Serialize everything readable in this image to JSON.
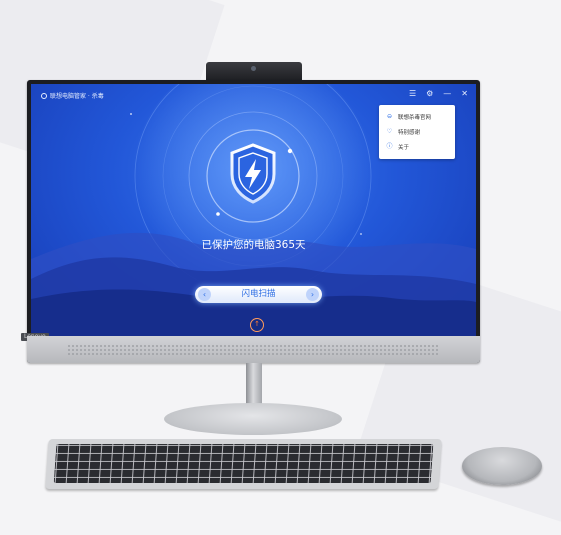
{
  "app": {
    "title": "联想电脑管家 · 杀毒",
    "controls": {
      "menu": "☰",
      "settings": "⚙",
      "minimize": "—",
      "close": "✕"
    }
  },
  "menu": {
    "items": [
      {
        "label": "联想杀毒官网",
        "icon": "web-icon"
      },
      {
        "label": "特别感谢",
        "icon": "thanks-icon"
      },
      {
        "label": "关于",
        "icon": "info-icon"
      }
    ]
  },
  "status": {
    "text": "已保护您的电脑365天"
  },
  "scan": {
    "label": "闪电扫描",
    "left_arrow": "‹",
    "right_arrow": "›"
  },
  "up_button": {
    "glyph": "↑"
  },
  "hardware": {
    "brand": "Lenovo"
  },
  "colors": {
    "screen_top": "#3a78ee",
    "screen_bottom": "#173bb4",
    "accent": "#2f6fe4",
    "up_button": "#ff7a2f"
  }
}
